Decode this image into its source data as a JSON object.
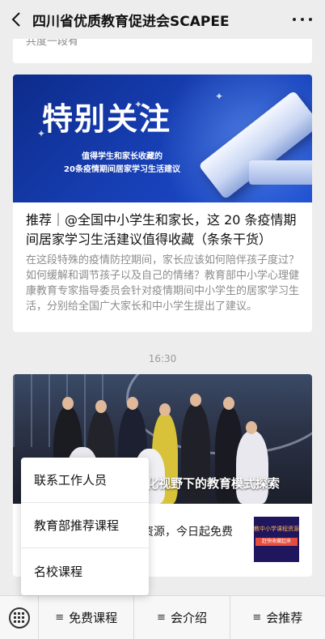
{
  "header": {
    "title": "四川省优质教育促进会SCAPEE"
  },
  "feed": {
    "top_snippet": "共度一段有",
    "article1": {
      "hero_title": "特别关注",
      "hero_sub1": "值得学生和家长收藏的",
      "hero_sub2": "20条疫情期间居家学习生活建议",
      "headline": "推荐｜@全国中小学生和家长，这 20 条疫情期间居家学习生活建议值得收藏（条条干货）",
      "desc": "在这段特殊的疫情防控期间，家长应该如何陪伴孩子度过？如何缓解和调节孩子以及自己的情绪？教育部中小学心理健康教育专家指导委员会针对疫情期间中小学生的居家学习生活，分别给全国广大家长和中小学生提出了建议。"
    },
    "timestamp": "16:30",
    "article2": {
      "caption": "际化视野下的教育模式探索",
      "snippet": "资源，今日起免费",
      "thumb_text1": "教中小学课程资源",
      "thumb_text2": "赶快收藏起来"
    }
  },
  "menu": {
    "items": [
      "联系工作人员",
      "教育部推荐课程",
      "名校课程"
    ]
  },
  "bottom_bar": {
    "tabs": [
      "免费课程",
      "会介绍",
      "会推荐"
    ]
  }
}
